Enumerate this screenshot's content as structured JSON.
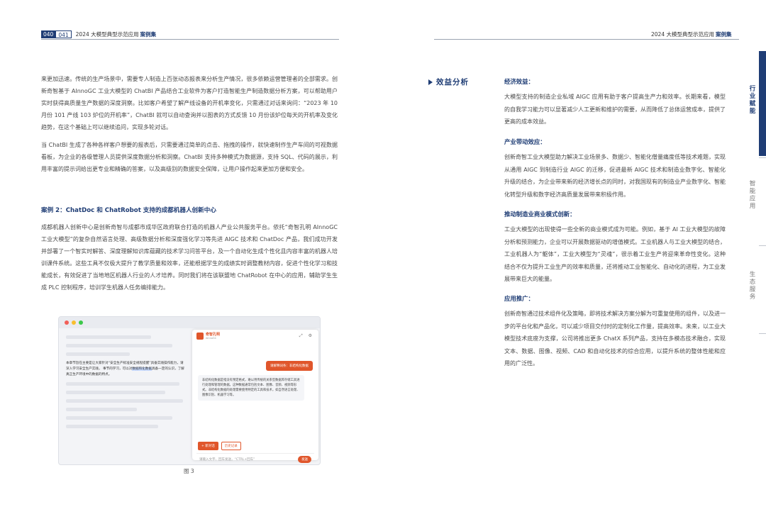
{
  "header": {
    "page_left": "040",
    "page_right": "041",
    "title_left": "2024 大模型典型示范应用",
    "title_left_strong": "案例集",
    "title_right": "2024 大模型典型示范应用",
    "title_right_strong": "案例集"
  },
  "left": {
    "p1": "来更加迅速。传统的生产场景中，需要专人制造上百张动态报表来分析生产情况，很多依赖运营管理者的全部需求。创新奇智基于 AInnoGC 工业大模型的 ChatBI 产品结合工业软件为客户打造智能生产制造数据分析方案，可以帮助用户实时获得高质量生产数据的深度洞察。比如客户希望了解产线设备的开机率变化，只需通过对话来询问：“2023 年 10 月份 101 产线 103 炉位的开机率”，ChatBI 就可以自动查询并以图表的方式反馈 10 月份该炉位每天的开机率及变化趋势，在这个基础上可以继续追问，实现多轮对话。",
    "p2": "当 ChatBI 生成了各种各样客户想要的报表后，只需要通过简单的点击、拖拽的操作，就快速制作生产车间的可视数据看板，为企业的各级管理人员提供深度数据分析和洞察。ChatBI 支持多种模式为数据源，支持 SQL、代码的展示，利用丰富的提示词给出更专业和精确的答案，以及高级别的数据安全保障，让用户操作起来更加方便和安全。",
    "case_title": "案例 2：ChatDoc 和 ChatRobot 支持的成都机器人创新中心",
    "p3": "成都机器人创新中心是创新奇智与成都市成华区政府联合打造的机器人产业公共服务平台。依托“奇智孔明 AInnoGC 工业大模型”的复杂自然语言处理、高级数据分析和深度强化学习等先进 AIGC 技术和 ChatDoc 产品，我们成功开发并部署了一个智实时解答、深度理解知识库蕴藏的技术学习问答平台，及一个自动化生成个性化且内容丰富的机器人培训课件系统。这些工具不仅极大提升了教学质量和效率，还能根据学生的成绩实时调整教材内容，促进个性化学习和技能成长，有效促进了当地地区机器人行业的人才培养。同时我们将在该联盟地 ChatRobot 在中心的应用，辅助学生生成 PLC 控制程序，培训学生机器人任务编排能力。",
    "figure_caption": "图 3"
  },
  "screenshot": {
    "doc_text_pre": "本章节旨在主要是让大家针对“安全生产标准安全规程提醒”具备实践操作能力，请深入学习安全生产实践，",
    "doc_text_mid": "事节的学习，可以对",
    "doc_text_highlight": "数据和化数据",
    "doc_text_post": "具备一定的认识，了解真正生产环境中的数据的特点。",
    "brand_name": "奇智孔明",
    "brand_sub": "AInnoGC",
    "top_icons": "⤢ ⚙",
    "user_question": "请解释词条：非结构化数据",
    "bot_answer": "非结构化数据是指没有预定格式，难以用传统的关系型数据库存储工具进行处理和管理的数据。这种数据通常包括文本、图像、音频、视频等形式。非结构化数据的处理需要使用特定的工具和技术，如自然语言处理、图像识别、机器学习等。",
    "btn_new": "+ 新对话",
    "btn_history": "历史记录",
    "input_placeholder": "请输入文字、回车发送，“CTRL+回车”",
    "send_label": "发送"
  },
  "right": {
    "section_title": "效益分析",
    "h1": "经济效益：",
    "r1": "大模型支持的制造企业私域 AIGC 应用有助于客户提高生产力和效率。长期来看，模型的自我学习能力可以显著减少人工更新和维护的需要，从而降低了总体运营成本，提供了更高的成本效益。",
    "h2": "产业带动效应：",
    "r2": "创新奇智工业大模型助力解决工业场景多、数据少、智能化僧量痛度低等技术难题，实现从通用 AIGC 到制造行业 AIGC 的迁移，促进最新 AIGC 技术和制造业数字化、智能化升级的结合，为企业带来新的经济增长点的同时，对我国现有的制造业产业数字化、智能化转型升级和数字经济高质量发展带来积极作用。",
    "h3": "推动制造业商业模式创新：",
    "r3": "工业大模型的出现使得一些全新的商业模式成为可能。例如，基于 AI 工业大模型的故障分析和预测能力，企业可以开展数据驱动的增值模式。工业机器人与工业大模型的结合，工业机器人为“躯体”，工业大模型为“灵魂”，很示着工业生产将迎来革命性变化。这种结合不仅为提升工业生产的效率和质量，还将推动工业智能化、自动化的进程，为工业发展带来巨大的能量。",
    "h4": "应用推广：",
    "r4": "创新奇智通过技术组件化及策略，即将技术解决方案分解为可重复使用的组件，以及进一步的平台化和产品化，可以减少项目交付时的定制化工作量，提高效率。未来，以工业大模型技术底座为支撑，公司将推出更多 ChatX 系列产品，支持在多模态技术融合，实现文本、数据、图像、视频、CAD 和自动化技术的综合应用，以提升系统的整体性能和应用的广泛性。"
  },
  "side_tabs": {
    "tab1": "行业赋能",
    "tab2": "智能应用",
    "tab3": "生态服务"
  },
  "colors": {
    "brand_navy": "#1f3d75",
    "accent_orange": "#e0562b"
  }
}
